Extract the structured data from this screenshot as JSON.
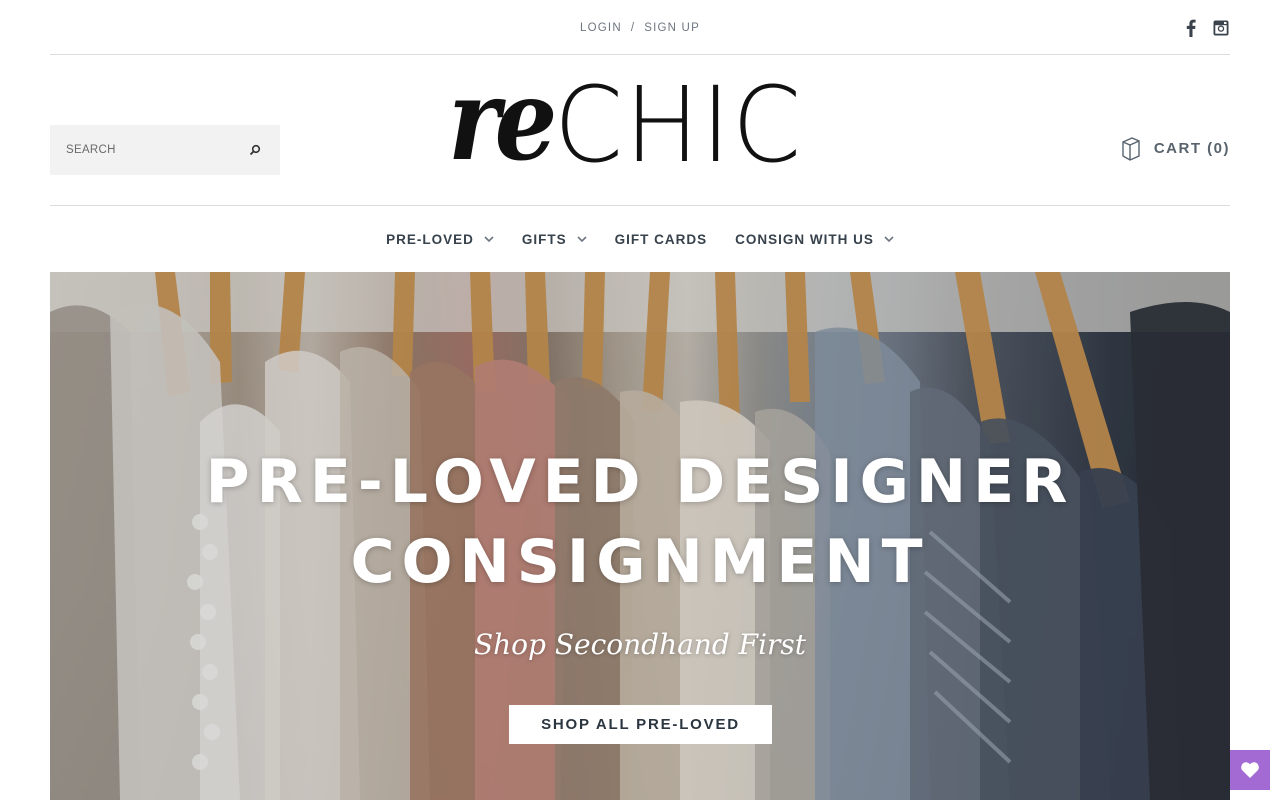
{
  "auth": {
    "login": "LOGIN",
    "separator": "/",
    "signup": "SIGN UP"
  },
  "social": {
    "icons": [
      "facebook-icon",
      "instagram-icon"
    ]
  },
  "search": {
    "placeholder": "SEARCH"
  },
  "logo": {
    "part1": "re",
    "part2": "CHIC"
  },
  "cart": {
    "label": "CART (0)"
  },
  "nav": {
    "items": [
      {
        "label": "PRE-LOVED",
        "has_dropdown": true
      },
      {
        "label": "GIFTS",
        "has_dropdown": true
      },
      {
        "label": "GIFT CARDS",
        "has_dropdown": false
      },
      {
        "label": "CONSIGN WITH US",
        "has_dropdown": true
      }
    ]
  },
  "hero": {
    "headline_line1": "PRE-LOVED DESIGNER",
    "headline_line2": "CONSIGNMENT",
    "tagline": "Shop Secondhand First",
    "cta": "SHOP ALL PRE-LOVED"
  },
  "colors": {
    "wishlist_accent": "#a36ad4",
    "text_dark": "#2f3a45",
    "text_muted": "#6d7680"
  }
}
